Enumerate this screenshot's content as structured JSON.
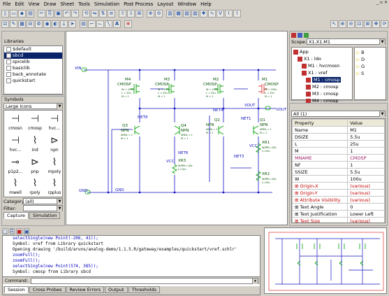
{
  "menu": [
    "File",
    "Edit",
    "View",
    "Draw",
    "Sheet",
    "Tools",
    "Simulation",
    "Post Process",
    "Layout",
    "Window",
    "Help"
  ],
  "window_controls": "_ ▫ ×",
  "libraries": {
    "title": "Libraries",
    "items": [
      "$default",
      "sbcd",
      "spicelib",
      "basiclib",
      "back_annotate",
      "quickstart"
    ],
    "selected": 1
  },
  "symbols": {
    "title": "Symbols",
    "view_mode": "Large Icons",
    "items": [
      {
        "label": "cmosn",
        "glyph": "⊣"
      },
      {
        "label": "cmosp",
        "glyph": "⊣"
      },
      {
        "label": "hvc...",
        "glyph": "⊣"
      },
      {
        "label": "hvc...",
        "glyph": "⊣"
      },
      {
        "label": "ind",
        "glyph": "⌇"
      },
      {
        "label": "npn",
        "glyph": "⊳"
      },
      {
        "label": "p1p2...",
        "glyph": "⊸"
      },
      {
        "label": "pnp",
        "glyph": "⊳"
      },
      {
        "label": "mpoly",
        "glyph": "⌇"
      },
      {
        "label": "mwell",
        "glyph": "⌇"
      },
      {
        "label": "rpoly",
        "glyph": "⌇"
      },
      {
        "label": "rpplus",
        "glyph": "⌇"
      }
    ],
    "category_label": "Category:",
    "category_value": "(all)",
    "filter_label": "Filter:",
    "filter_value": "",
    "tabs": [
      "Capture",
      "Simulation"
    ]
  },
  "schematic": {
    "wire_color": "#1010c0",
    "device_color": "#00a000",
    "labels": {
      "vin": "VIN",
      "gnd": "GND",
      "gnd2": "GND",
      "vout": "VOUT",
      "vout2": "VOUT",
      "net8": "NET8",
      "net4": "NET4",
      "net1": "NET1",
      "net3": "NET3",
      "net6": "NET6",
      "vcc1": "VCC",
      "vcc2": "VCC"
    },
    "devices": [
      {
        "name": "M4",
        "type": "CMOSP",
        "params": [
          "W = 100u",
          "L = 25u",
          "M = 1"
        ]
      },
      {
        "name": "M3",
        "type": "CMOSP",
        "params": [
          "W = 100u",
          "L = 25u",
          "M = 1"
        ]
      },
      {
        "name": "M2",
        "type": "CMOSP",
        "params": [
          "W = 100u",
          "L = 25u",
          "M = 1"
        ]
      },
      {
        "name": "M1",
        "type": "CMOSP",
        "params": [
          "W = 100u",
          "L = 25u",
          "M = 1"
        ]
      },
      {
        "name": "Q3",
        "type": "NPN",
        "params": [
          "AREA = 1",
          "M = 1"
        ]
      },
      {
        "name": "Q4",
        "type": "NPN",
        "params": [
          "AREA = 1",
          "M = 1"
        ]
      },
      {
        "name": "Q2",
        "type": "NPN",
        "params": [
          "AREA = 1",
          "M = 1"
        ]
      },
      {
        "name": "Q1",
        "type": "NPN",
        "params": [
          "AREA = 1",
          "M = 1"
        ]
      },
      {
        "name": "XR3",
        "type": "",
        "params": [
          "W/RPL=10k",
          "L=10u"
        ]
      },
      {
        "name": "XR1",
        "type": "",
        "params": [
          "W/RPL=10k",
          "L=10u"
        ]
      },
      {
        "name": "XR2",
        "type": "",
        "params": [
          "W/RPL=10k",
          "L=10u"
        ]
      }
    ]
  },
  "hierarchy": {
    "scope_label": "Scope:",
    "scope_value": "X1.X1.M1",
    "items": [
      {
        "label": "App",
        "indent": 0,
        "selected": false
      },
      {
        "label": "X1 : ldo",
        "indent": 1,
        "selected": false
      },
      {
        "label": "M1 : hvcmosn",
        "indent": 2,
        "selected": false
      },
      {
        "label": "X1 : vref",
        "indent": 2,
        "selected": false
      },
      {
        "label": "M1 : cmosp",
        "indent": 3,
        "selected": true
      },
      {
        "label": "M2 : cmosp",
        "indent": 3,
        "selected": false
      },
      {
        "label": "M3 : cmosp",
        "indent": 3,
        "selected": false
      },
      {
        "label": "M4 : cmosp",
        "indent": 3,
        "selected": false
      }
    ],
    "pins": [
      "B",
      "D",
      "G",
      "S"
    ]
  },
  "properties": {
    "filter": "All (1)",
    "headers": [
      "Property",
      "Value"
    ],
    "rows": [
      {
        "k": "Name",
        "v": "M1",
        "style": ""
      },
      {
        "k": "DSIZE",
        "v": "5.5u",
        "style": ""
      },
      {
        "k": "L",
        "v": "25u",
        "style": ""
      },
      {
        "k": "M",
        "v": "1",
        "style": ""
      },
      {
        "k": "MNAME",
        "v": "CMOSP",
        "style": "mag"
      },
      {
        "k": "NF",
        "v": "1",
        "style": ""
      },
      {
        "k": "SSIZE",
        "v": "5.5u",
        "style": ""
      },
      {
        "k": "W",
        "v": "100u",
        "style": ""
      },
      {
        "k": "⊞ Origin-X",
        "v": "(various)",
        "style": "red"
      },
      {
        "k": "⊞ Origin-Y",
        "v": "(various)",
        "style": "red"
      },
      {
        "k": "⊞ Attribute Visibility",
        "v": "(various)",
        "style": "red"
      },
      {
        "k": "⊞ Text Angle",
        "v": "0",
        "style": ""
      },
      {
        "k": "⊞ Text Justification",
        "v": "Lower Left",
        "style": ""
      },
      {
        "k": "⊞ Text Size",
        "v": "(various)",
        "style": "red"
      }
    ]
  },
  "console": {
    "lines": [
      {
        "t": "selectSingle(new Point(-206, 41));",
        "c": "b"
      },
      {
        "t": "Symbol: vref from Library quickstart",
        "c": ""
      },
      {
        "t": "Opening drawing '/build/aruns/analog-demo/1.1.5.R/gateway/examples/quickstart/vref.schlr'",
        "c": ""
      },
      {
        "t": "zoomFull();",
        "c": "b"
      },
      {
        "t": "zoomFull();",
        "c": "b"
      },
      {
        "t": "selectSingle(new Point(574, 385));",
        "c": "b"
      },
      {
        "t": "Symbol: cmosp from Library sbcd",
        "c": ""
      }
    ],
    "command_label": "Command:",
    "command_value": "",
    "tabs": [
      "Session",
      "Cross Probes",
      "Review Errors",
      "Output",
      "Thresholds"
    ]
  }
}
